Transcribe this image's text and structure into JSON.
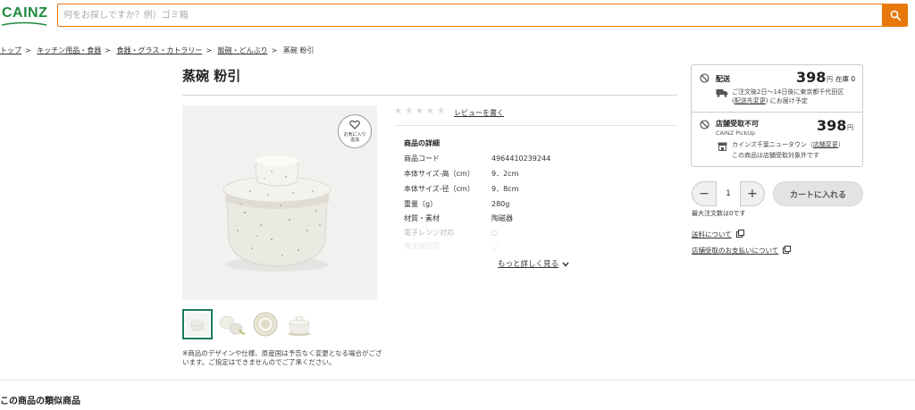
{
  "header": {
    "logo": "CAINZ",
    "search_placeholder": "何をお探しですか？例）ゴミ箱",
    "brand_color": "#1e8a3e",
    "accent_color": "#e8780c"
  },
  "breadcrumb": [
    "トップ",
    "キッチン用品・食器",
    "食器・グラス・カトラリー",
    "飯碗・どんぶり",
    "蒸碗 粉引"
  ],
  "product": {
    "title": "蒸碗 粉引",
    "favorite_label_1": "お気に入り",
    "favorite_label_2": "追加",
    "note": "※商品のデザインや仕様、原産国は予告なく変更となる場合がございます。ご指定はできませんのでご了承ください。",
    "review_link": "レビューを書く",
    "rating_stars": 0,
    "detail_title": "商品の詳細",
    "specs": [
      {
        "key": "商品コード",
        "value": "4964410239244"
      },
      {
        "key": "本体サイズ-高（cm）",
        "value": "9．2cm"
      },
      {
        "key": "本体サイズ-径（cm）",
        "value": "9．8cm"
      },
      {
        "key": "重量（g）",
        "value": "280g"
      },
      {
        "key": "材質・素材",
        "value": "陶磁器"
      },
      {
        "key": "電子レンジ対応",
        "value": "○"
      },
      {
        "key": "食洗機対応",
        "value": "○"
      }
    ],
    "more_link": "もっと詳しく見る"
  },
  "purchase": {
    "delivery_label": "配送",
    "delivery_price": "398",
    "yen": "円",
    "stock": "在庫 0",
    "delivery_note_1": "ご注文後2日〜14日後に東京都千代田区",
    "delivery_change": "配送先変更",
    "delivery_note_2": "にお届け予定",
    "store_label": "店舗受取不可",
    "store_sub": "CAINZ PickUp",
    "store_price": "398",
    "store_name_prefix": "カインズ千葉ニュータウン（",
    "store_change": "店舗変更",
    "store_name_suffix": "）",
    "store_note": "この商品は店舗受取対象外です",
    "quantity": "1",
    "minus": "−",
    "plus": "+",
    "cart_button": "カートに入れる",
    "limit_text": "最大注文数は0です",
    "shipping_link": "送料について",
    "payment_link": "店舗受取のお支払いについて"
  },
  "similar_title": "この商品の類似商品"
}
